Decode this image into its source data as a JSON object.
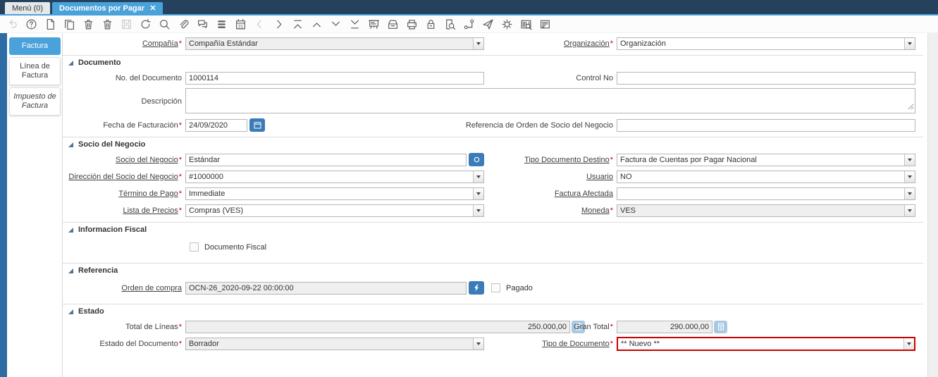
{
  "topbar": {
    "menu_tab": "Menú (0)",
    "active_tab": "Documentos por Pagar"
  },
  "toolbar": {
    "icons": [
      {
        "name": "undo-icon",
        "disabled": true
      },
      {
        "name": "help-icon"
      },
      {
        "name": "new-record-icon"
      },
      {
        "name": "copy-record-icon"
      },
      {
        "name": "delete-record-icon"
      },
      {
        "name": "delete-selection-icon"
      },
      {
        "name": "save-icon",
        "disabled": true
      },
      {
        "name": "refresh-icon"
      },
      {
        "name": "find-icon"
      },
      {
        "name": "attachment-icon"
      },
      {
        "name": "chat-icon"
      },
      {
        "name": "grid-toggle-icon"
      },
      {
        "name": "calendar-icon"
      },
      {
        "name": "parent-record-icon",
        "disabled": true
      },
      {
        "name": "detail-record-icon"
      },
      {
        "name": "first-record-icon"
      },
      {
        "name": "previous-record-icon"
      },
      {
        "name": "next-record-icon"
      },
      {
        "name": "last-record-icon"
      },
      {
        "name": "report-icon"
      },
      {
        "name": "archive-icon"
      },
      {
        "name": "print-icon"
      },
      {
        "name": "lock-icon"
      },
      {
        "name": "record-info-icon"
      },
      {
        "name": "workflow-icon"
      },
      {
        "name": "request-icon"
      },
      {
        "name": "preference-icon"
      },
      {
        "name": "product-info-icon"
      },
      {
        "name": "report-window-icon"
      }
    ]
  },
  "sidebar": {
    "tabs": [
      {
        "label": "Factura",
        "active": true
      },
      {
        "label": "Línea de Factura"
      },
      {
        "label": "Impuesto de Factura",
        "italic": true
      }
    ]
  },
  "required_marker": "*",
  "sections": {
    "documento": "Documento",
    "socio": "Socio del Negocio",
    "fiscal": "Informacion Fiscal",
    "referencia": "Referencia",
    "estado": "Estado"
  },
  "fields": {
    "compania": {
      "label": "Compañía",
      "value": "Compañía Estándar"
    },
    "organizacion": {
      "label": "Organización",
      "value": "Organización"
    },
    "no_documento": {
      "label": "No. del Documento",
      "value": "1000114"
    },
    "control_no": {
      "label": "Control No",
      "value": ""
    },
    "descripcion": {
      "label": "Descripción",
      "value": ""
    },
    "fecha_facturacion": {
      "label": "Fecha de Facturación",
      "value": "24/09/2020"
    },
    "referencia_orden": {
      "label": "Referencia de Orden de Socio del Negocio",
      "value": ""
    },
    "socio_negocio": {
      "label": "Socio del Negocio",
      "value": "Estándar"
    },
    "tipo_doc_destino": {
      "label": "Tipo Documento Destino",
      "value": "Factura de Cuentas por Pagar Nacional"
    },
    "direccion_socio": {
      "label": "Dirección del Socio del Negocio",
      "value": "#1000000"
    },
    "usuario": {
      "label": "Usuario",
      "value": "NO"
    },
    "termino_pago": {
      "label": "Término de Pago",
      "value": "Immediate"
    },
    "factura_afectada": {
      "label": "Factura Afectada",
      "value": ""
    },
    "lista_precios": {
      "label": "Lista de Precios",
      "value": "Compras (VES)"
    },
    "moneda": {
      "label": "Moneda",
      "value": "VES"
    },
    "documento_fiscal": {
      "label": "Documento Fiscal",
      "checked": false
    },
    "orden_compra": {
      "label": "Orden de compra",
      "value": "OCN-26_2020-09-22 00:00:00"
    },
    "pagado": {
      "label": "Pagado",
      "checked": false
    },
    "total_lineas": {
      "label": "Total de Líneas",
      "value": "250.000,00"
    },
    "gran_total": {
      "label": "Gran Total",
      "value": "290.000,00"
    },
    "estado_documento": {
      "label": "Estado del Documento",
      "value": "Borrador"
    },
    "tipo_documento": {
      "label": "Tipo de Documento",
      "value": "** Nuevo **",
      "highlighted": true
    }
  },
  "colors": {
    "accent": "#4aa2da",
    "topbar_bg": "#24425e",
    "left_bar": "#2d6ca2",
    "action_button": "#3a7cb8",
    "calc_button": "#a9c9e2",
    "highlight_border": "#cc0000",
    "required": "#cc0000",
    "readonly_bg": "#efefef"
  }
}
